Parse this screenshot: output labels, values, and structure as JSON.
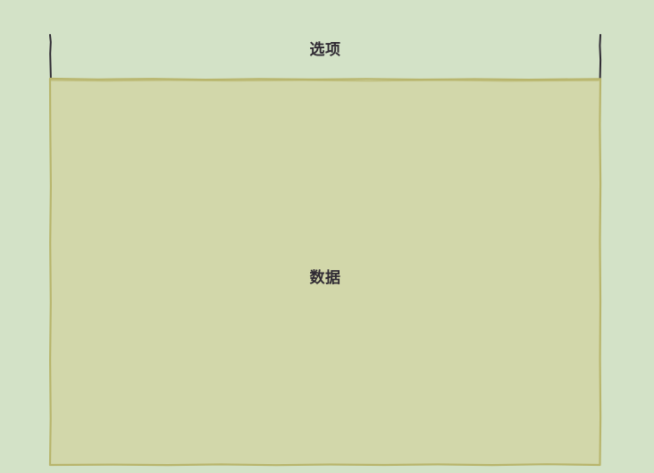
{
  "header": {
    "label": "选项"
  },
  "body": {
    "label": "数据"
  },
  "colors": {
    "background": "#d3e2c7",
    "data_fill": "#d2d7aa",
    "data_stroke": "#b8b56c",
    "header_stroke": "#2f2a33",
    "text": "#2f2a33"
  }
}
